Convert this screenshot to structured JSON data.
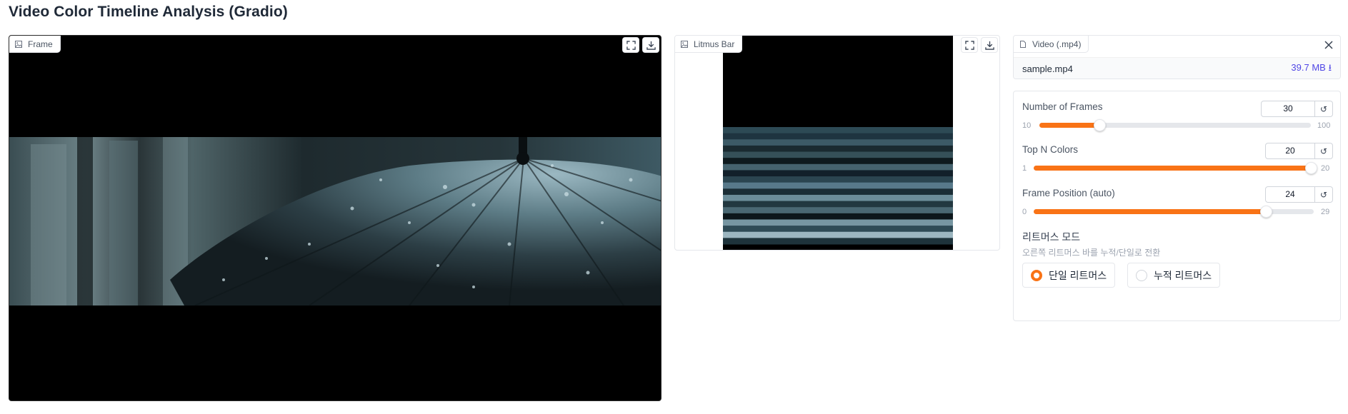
{
  "app": {
    "title": "Video Color Timeline Analysis (Gradio)"
  },
  "frame_panel": {
    "label": "Frame",
    "icons": [
      "image-icon",
      "fullscreen-icon",
      "download-icon"
    ]
  },
  "litmus_panel": {
    "label": "Litmus Bar",
    "stripes": [
      "#000000",
      "#000000",
      "#2d4a55",
      "#1e3440",
      "#3c5a66",
      "#1a2a30",
      "#355058",
      "#0e1a1e",
      "#45636e",
      "#12202a",
      "#2b4550",
      "#58798a",
      "#1b2e36",
      "#6c8d99",
      "#223840",
      "#4a6873",
      "#0d171c",
      "#7796a2",
      "#2f4b56",
      "#9cb6c0",
      "#1e333b"
    ]
  },
  "video_panel": {
    "label": "Video (.mp4)",
    "file_name": "sample.mp4",
    "file_size": "39.7 MB ⭳"
  },
  "controls": {
    "frames": {
      "label": "Number of Frames",
      "value": "30",
      "min": "10",
      "max": "100",
      "fraction": 0.222
    },
    "topn": {
      "label": "Top N Colors",
      "value": "20",
      "min": "1",
      "max": "20",
      "fraction": 1.0
    },
    "position": {
      "label": "Frame Position (auto)",
      "value": "24",
      "min": "0",
      "max": "29",
      "fraction": 0.828
    },
    "reset_glyph": "↺"
  },
  "mode": {
    "title": "리트머스 모드",
    "info": "오른쪽 리트머스 바를 누적/단일로 전환",
    "options": [
      {
        "label": "단일 리트머스",
        "selected": true
      },
      {
        "label": "누적 리트머스",
        "selected": false
      }
    ]
  },
  "colors": {
    "accent": "#f97316",
    "link": "#4f46e5"
  }
}
